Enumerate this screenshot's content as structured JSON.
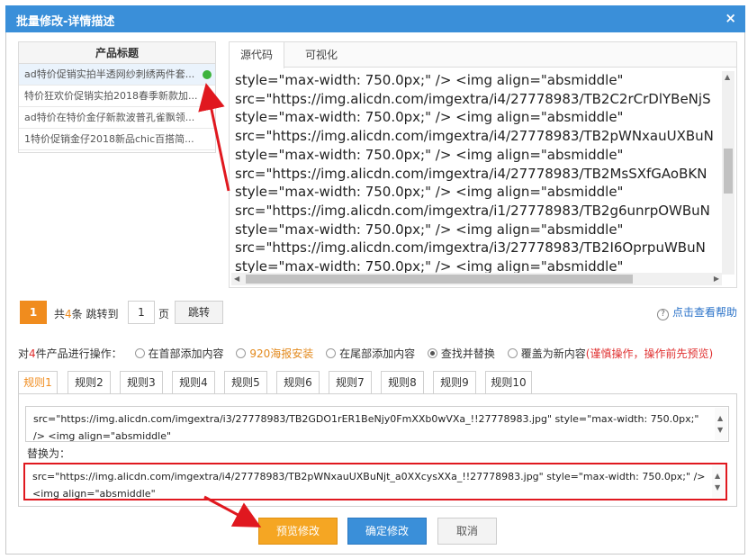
{
  "dialog": {
    "title": "批量修改-详情描述",
    "close": "×"
  },
  "product_list": {
    "header": "产品标题",
    "items": [
      "ad特价促销实拍半透网纱刺绣两件套...",
      "特价狂欢价促销实拍2018春季新款加...",
      "ad特价在特价金仔新款波普孔雀飘领...",
      "1特价促销金仔2018新品chic百搭简..."
    ]
  },
  "editor": {
    "tabs": [
      "源代码",
      "可视化"
    ],
    "lines": [
      "style=\"max-width: 750.0px;\" /> <img align=\"absmiddle\"",
      "src=\"https://img.alicdn.com/imgextra/i4/27778983/TB2C2rCrDlYBeNjS",
      "style=\"max-width: 750.0px;\" /> <img align=\"absmiddle\"",
      "src=\"https://img.alicdn.com/imgextra/i4/27778983/TB2pWNxauUXBuN",
      "style=\"max-width: 750.0px;\" /> <img align=\"absmiddle\"",
      "src=\"https://img.alicdn.com/imgextra/i4/27778983/TB2MsSXfGAoBKN",
      "style=\"max-width: 750.0px;\" /> <img align=\"absmiddle\"",
      "src=\"https://img.alicdn.com/imgextra/i1/27778983/TB2g6unrpOWBuN",
      "style=\"max-width: 750.0px;\" /> <img align=\"absmiddle\"",
      "src=\"https://img.alicdn.com/imgextra/i3/27778983/TB2I6OprpuWBuN",
      "style=\"max-width: 750.0px;\" /> <img align=\"absmiddle\""
    ]
  },
  "pager": {
    "current": "1",
    "total_prefix": "共",
    "total_count": "4",
    "total_suffix": "条 跳转到",
    "page_input": "1",
    "page_unit": "页",
    "jump": "跳转"
  },
  "help": {
    "label": "点击查看帮助"
  },
  "operations": {
    "prefix": "对",
    "count": "4",
    "suffix": "件产品进行操作：",
    "options": [
      "在首部添加内容",
      "920海报安装",
      "在尾部添加内容",
      "查找并替换",
      "覆盖为新内容"
    ],
    "selected_index": 3,
    "warning": "(谨慎操作，操作前先预览)"
  },
  "rules": {
    "tabs": [
      "规则1",
      "规则2",
      "规则3",
      "规则4",
      "规则5",
      "规则6",
      "规则7",
      "规则8",
      "规则9",
      "规则10"
    ],
    "find_text": "src=\"https://img.alicdn.com/imgextra/i3/27778983/TB2GDO1rER1BeNjy0FmXXb0wVXa_!!27778983.jpg\" style=\"max-width: 750.0px;\" /> <img align=\"absmiddle\"",
    "replace_label": "替换为：",
    "replace_text": "src=\"https://img.alicdn.com/imgextra/i4/27778983/TB2pWNxauUXBuNjt_a0XXcysXXa_!!27778983.jpg\" style=\"max-width: 750.0px;\" /> <img align=\"absmiddle\""
  },
  "buttons": {
    "preview": "预览修改",
    "confirm": "确定修改",
    "cancel": "取消"
  },
  "colors": {
    "title_bar": "#3a8fd9",
    "accent": "#f08c1e",
    "annotation": "#e0181f"
  }
}
